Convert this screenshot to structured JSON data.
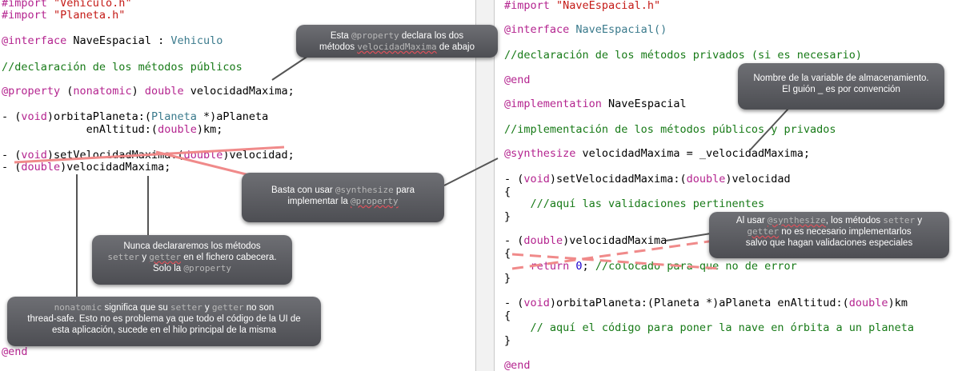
{
  "left_code": {
    "import1_kw": "#import",
    "import1_str": " \"Vehiculo.h\"",
    "import2_kw": "#import",
    "import2_str": " \"Planeta.h\"",
    "interface_kw": "@interface",
    "interface_rest": " NaveEspacial : ",
    "interface_super": "Vehiculo",
    "comment_public": "//declaración de los métodos públicos",
    "property_kw": "@property",
    "property_a": " (",
    "property_attr": "nonatomic",
    "property_b": ") ",
    "property_type": "double",
    "property_rest": " velocidadMaxima;",
    "orbit_a": "- (",
    "orbit_void": "void",
    "orbit_b": ")orbitaPlaneta:(",
    "orbit_type": "Planeta",
    "orbit_c": " *)aPlaneta",
    "orbit2_a": "             enAltitud:(",
    "orbit2_type": "double",
    "orbit2_b": ")km;",
    "setter_a": "- (",
    "setter_void": "void",
    "setter_b": ")setVelocidadMaxima:(",
    "setter_type": "double",
    "setter_c": ")velocidad;",
    "getter_a": "- (",
    "getter_type": "double",
    "getter_b": ")velocidadMaxima;",
    "end_kw": "@end"
  },
  "right_code": {
    "import_kw": "#import",
    "import_str": " \"NaveEspacial.h\"",
    "interface_kw": "@interface",
    "interface_name": " NaveEspacial()",
    "comment_private": "//declaración de los métodos privados (si es necesario)",
    "end1_kw": "@end",
    "impl_kw": "@implementation",
    "impl_name": " NaveEspacial",
    "comment_impl": "//implementación de los métodos públicos y privados",
    "synth_kw": "@synthesize",
    "synth_rest": " velocidadMaxima = _velocidadMaxima;",
    "setter_a": "- (",
    "setter_void": "void",
    "setter_b": ")setVelocidadMaxima:(",
    "setter_type": "double",
    "setter_c": ")velocidad",
    "brace_open1": "{",
    "comment_valid": "    ///aquí las validaciones pertinentes",
    "brace_close1": "}",
    "getter_a": "- (",
    "getter_type": "double",
    "getter_b": ")velocidadMaxima",
    "brace_open2": "{",
    "return_kw": "    return",
    "return_num": " 0",
    "return_rest": "; ",
    "return_comment": "//colocado para que no de error",
    "brace_close2": "}",
    "orbit_a": "- (",
    "orbit_void": "void",
    "orbit_b": ")orbitaPlaneta:(Planeta *)aPlaneta enAltitud:(",
    "orbit_type": "double",
    "orbit_c": ")km",
    "brace_open3": "{",
    "comment_orbit": "    // aquí el código para poner la nave en órbita a un planeta",
    "brace_close3": "}",
    "end2_kw": "@end"
  },
  "annotations": {
    "property_note": {
      "t1": "Esta ",
      "m1": "@property",
      "t2": " declara los dos",
      "t3": "métodos ",
      "m2": "velocidadMaxima",
      "t4": " de abajo"
    },
    "synthesize_note": {
      "t1": "Basta con usar ",
      "m1": "@synthesize",
      "t2": " para",
      "t3": "implementar la ",
      "m2": "@property"
    },
    "header_note": {
      "t1": "Nunca declararemos los métodos",
      "m1": "setter",
      "t2": " y ",
      "m2": "getter",
      "t3": " en el fichero cabecera.",
      "t4": "Solo la ",
      "m3": "@property"
    },
    "nonatomic_note": {
      "m1": "nonatomic",
      "t1": " significa que su ",
      "m2": "setter",
      "t2": " y ",
      "m3": "getter",
      "t3": " no son",
      "t4": "thread-safe. Esto no es problema ya que todo el código de la UI de",
      "t5": "esta aplicación, sucede en el hilo principal de la misma"
    },
    "variable_note": {
      "t1": "Nombre de la variable de almacenamiento.",
      "t2": "El guión _ es por convención"
    },
    "synth_methods_note": {
      "t1": "Al usar ",
      "m1": "@synthesize",
      "t2": ", los métodos ",
      "m2": "setter",
      "t3": " y",
      "m3": "getter",
      "t4": " no es necesario implementarlos",
      "t5": "salvo que hagan validaciones especiales"
    }
  },
  "colors": {
    "keyword": "#b4248f",
    "type": "#3a7a8c",
    "string": "#c41a16",
    "comment": "#177a17",
    "number": "#1c00cf",
    "strike": "#f08a8a"
  }
}
